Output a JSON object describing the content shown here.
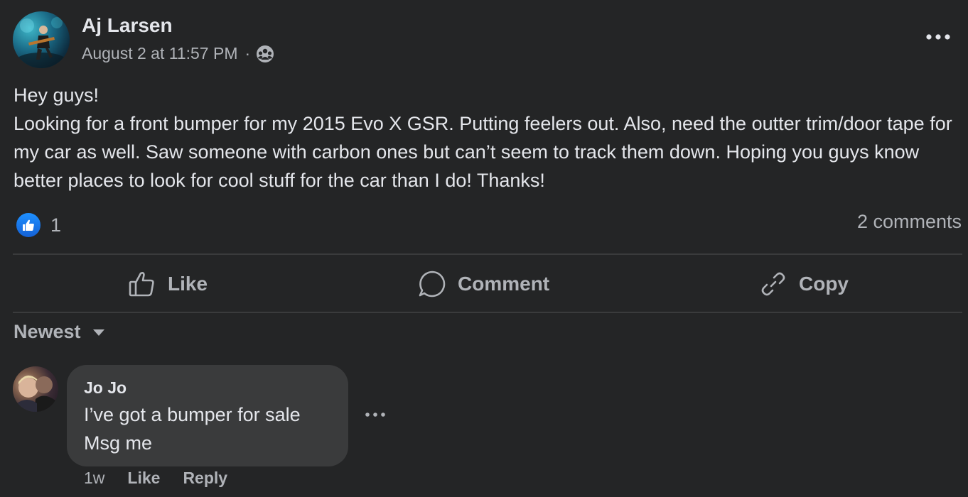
{
  "post": {
    "author": "Aj Larsen",
    "timestamp": "August 2 at 11:57 PM",
    "separator": "·",
    "audience_icon": "group-icon",
    "body": "Hey guys!\nLooking for a front bumper for my 2015 Evo X GSR. Putting feelers out. Also, need the outter trim/door tape for my car as well. Saw someone with carbon ones but can’t seem to track them down. Hoping you guys know better places to look for cool stuff for the car than I do! Thanks!",
    "reaction_count": "1",
    "comments_count": "2 comments"
  },
  "actions": {
    "like": "Like",
    "comment": "Comment",
    "copy": "Copy"
  },
  "sort": {
    "label": "Newest"
  },
  "comments": [
    {
      "author": "Jo Jo",
      "text": "I’ve got a bumper for sale\nMsg me",
      "time": "1w",
      "like": "Like",
      "reply": "Reply"
    }
  ],
  "colors": {
    "background": "#242526",
    "bubble": "#3a3b3c",
    "primary_text": "#e4e6eb",
    "secondary_text": "#b0b3b8",
    "like_blue": "#1877f2"
  }
}
